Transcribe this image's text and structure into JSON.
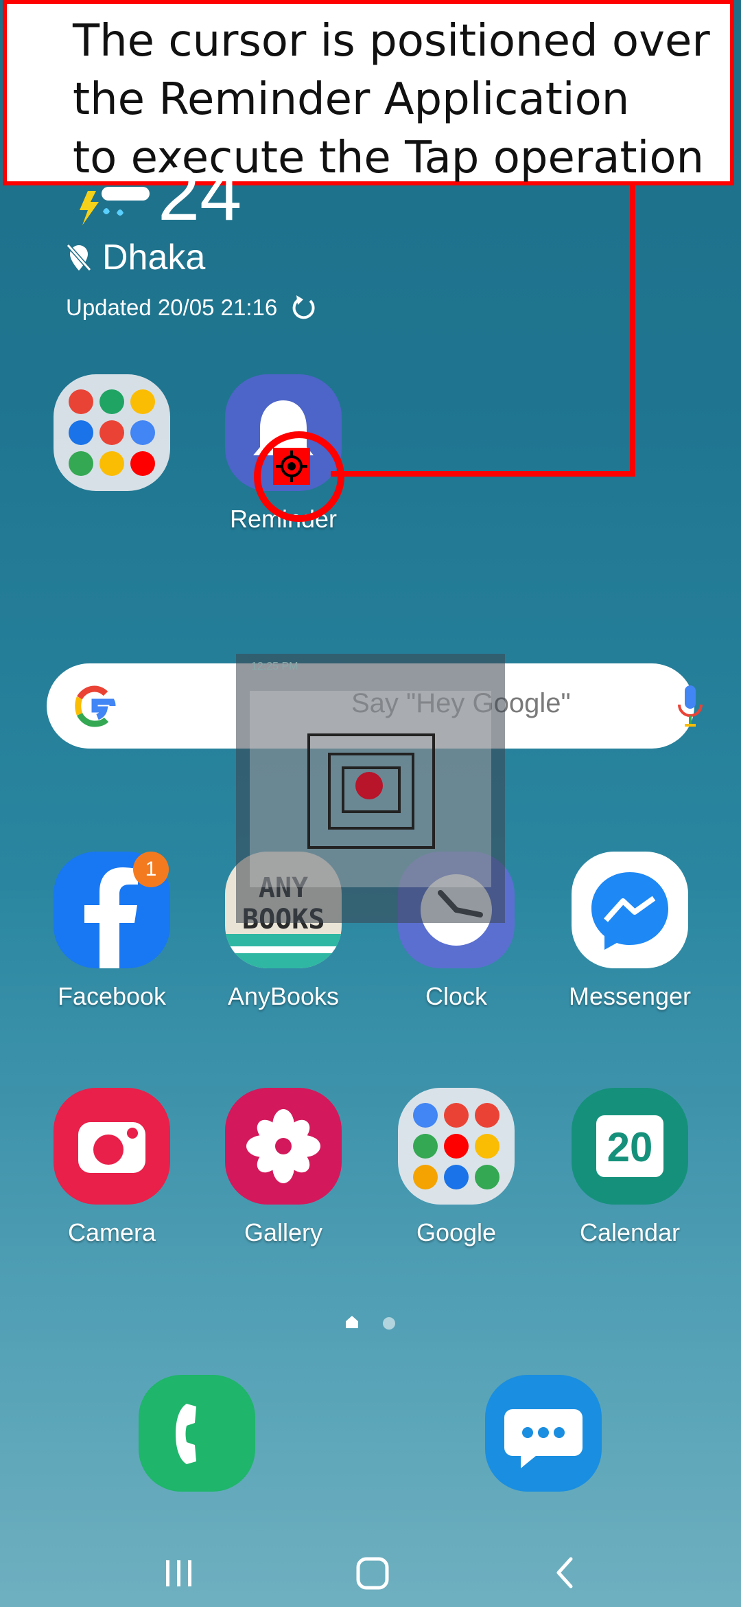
{
  "annotation": {
    "lines": [
      "The cursor is positioned over",
      "the Reminder Application",
      "to execute the Tap operation"
    ]
  },
  "weather": {
    "temperature": "24",
    "location": "Dhaka",
    "updated": "Updated 20/05 21:16"
  },
  "home_row1": [
    {
      "label": "",
      "icon": "app-folder-icon"
    },
    {
      "label": "Reminder",
      "icon": "bell-icon"
    }
  ],
  "search": {
    "placeholder": "Say \"Hey Google\""
  },
  "recorder_overlay": {
    "caption": "12:25 PM"
  },
  "apps_row2": [
    {
      "label": "Facebook",
      "icon": "facebook-icon",
      "badge": "1"
    },
    {
      "label": "AnyBooks",
      "icon": "anybooks-icon",
      "icon_text": "ANY BOOKS"
    },
    {
      "label": "Clock",
      "icon": "clock-icon"
    },
    {
      "label": "Messenger",
      "icon": "messenger-icon"
    }
  ],
  "apps_row3": [
    {
      "label": "Camera",
      "icon": "camera-icon"
    },
    {
      "label": "Gallery",
      "icon": "flower-icon"
    },
    {
      "label": "Google",
      "icon": "google-folder-icon"
    },
    {
      "label": "Calendar",
      "icon": "calendar-icon",
      "icon_text": "20"
    }
  ],
  "dock": [
    {
      "label": "",
      "icon": "phone-icon"
    },
    {
      "label": "",
      "icon": "messages-icon"
    }
  ],
  "colors": {
    "annotation_red": "#ff0000",
    "reminder_blue": "#4d64c8",
    "facebook_blue": "#1877f2",
    "camera_red": "#e8204a",
    "gallery_magenta": "#d3195b",
    "calendar_green": "#15917b",
    "phone_green": "#1fb56a",
    "messages_blue": "#1a8ee0"
  }
}
